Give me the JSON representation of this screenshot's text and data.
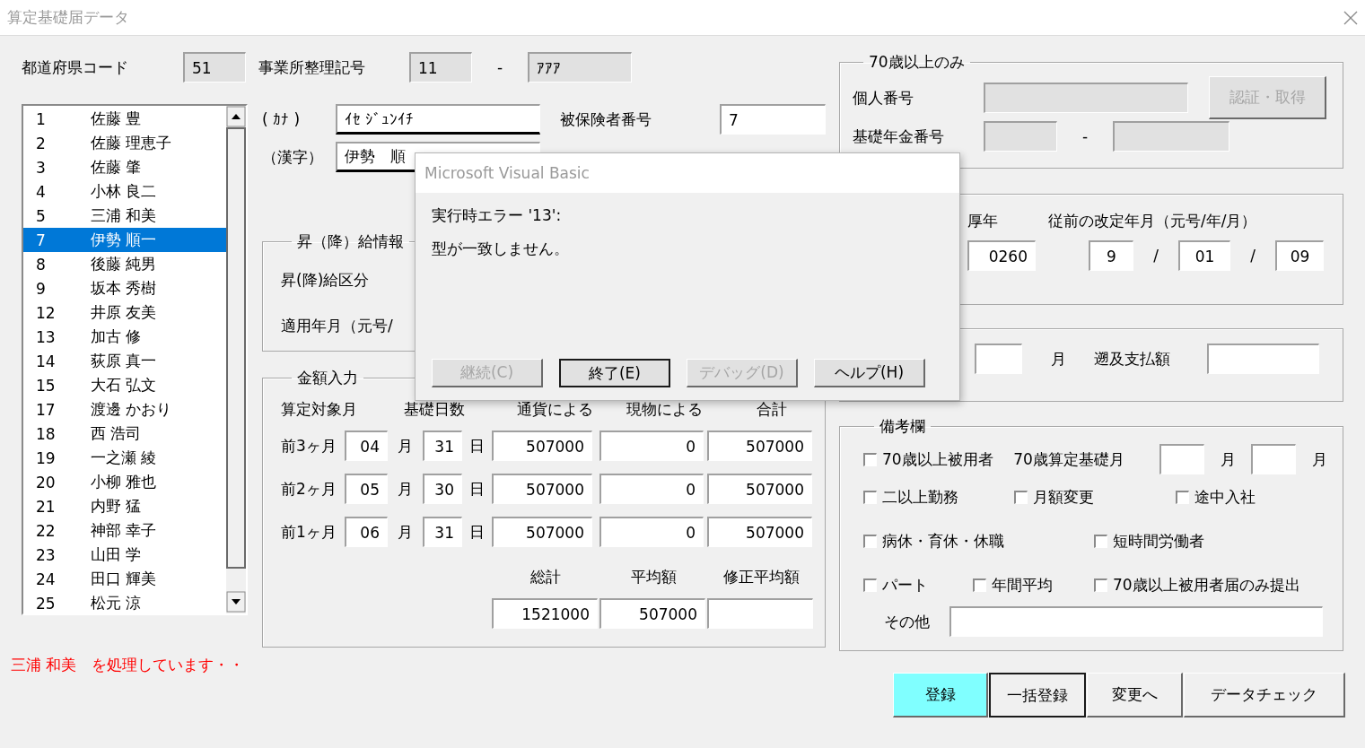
{
  "window": {
    "title": "算定基礎届データ"
  },
  "header": {
    "prefecture_label": "都道府県コード",
    "prefecture_code": "51",
    "office_label": "事業所整理記号",
    "office_code_1": "11",
    "office_separator": "-",
    "office_code_2": "ｱｱｱ"
  },
  "employee_list": [
    {
      "number": "1",
      "name": "佐藤 豊",
      "selected": false
    },
    {
      "number": "2",
      "name": "佐藤 理恵子",
      "selected": false
    },
    {
      "number": "3",
      "name": "佐藤 肇",
      "selected": false
    },
    {
      "number": "4",
      "name": "小林 良二",
      "selected": false
    },
    {
      "number": "5",
      "name": "三浦 和美",
      "selected": false
    },
    {
      "number": "7",
      "name": "伊勢 順一",
      "selected": true
    },
    {
      "number": "8",
      "name": "後藤 純男",
      "selected": false
    },
    {
      "number": "9",
      "name": "坂本 秀樹",
      "selected": false
    },
    {
      "number": "12",
      "name": "井原 友美",
      "selected": false
    },
    {
      "number": "13",
      "name": "加古 修",
      "selected": false
    },
    {
      "number": "14",
      "name": "荻原 真一",
      "selected": false
    },
    {
      "number": "15",
      "name": "大石 弘文",
      "selected": false
    },
    {
      "number": "17",
      "name": "渡邊 かおり",
      "selected": false
    },
    {
      "number": "18",
      "name": "西 浩司",
      "selected": false
    },
    {
      "number": "19",
      "name": "一之瀬 綾",
      "selected": false
    },
    {
      "number": "20",
      "name": "小柳 雅也",
      "selected": false
    },
    {
      "number": "21",
      "name": "内野 猛",
      "selected": false
    },
    {
      "number": "22",
      "name": "神部 幸子",
      "selected": false
    },
    {
      "number": "23",
      "name": "山田 学",
      "selected": false
    },
    {
      "number": "24",
      "name": "田口 輝美",
      "selected": false
    },
    {
      "number": "25",
      "name": "松元 涼",
      "selected": false
    }
  ],
  "status_message": "三浦 和美　を処理しています・・",
  "name_fields": {
    "kana_label": "( ｶﾅ )",
    "kana_value": "ｲｾ ｼﾞｭﾝｲﾁ",
    "insured_label": "被保険者番号",
    "insured_number": "7",
    "kanji_label": "（漢字）",
    "kanji_value": "伊勢　順"
  },
  "raise_info": {
    "title": "昇（降）給情報",
    "category_label": "昇(降)給区分",
    "applied_label": "適用年月（元号/"
  },
  "amounts": {
    "title": "金額入力",
    "headers": [
      "算定対象月",
      "基礎日数",
      "通貨による",
      "現物による",
      "合計"
    ],
    "rows": [
      {
        "label": "前3ヶ月",
        "month": "04",
        "month_unit": "月",
        "days": "31",
        "day_unit": "日",
        "cash": "507000",
        "in_kind": "0",
        "total": "507000"
      },
      {
        "label": "前2ヶ月",
        "month": "05",
        "month_unit": "月",
        "days": "30",
        "day_unit": "日",
        "cash": "507000",
        "in_kind": "0",
        "total": "507000"
      },
      {
        "label": "前1ヶ月",
        "month": "06",
        "month_unit": "月",
        "days": "31",
        "day_unit": "日",
        "cash": "507000",
        "in_kind": "0",
        "total": "507000"
      }
    ],
    "summary": [
      {
        "label": "総計",
        "value": "1521000"
      },
      {
        "label": "平均額",
        "value": "507000"
      },
      {
        "label": "修正平均額"
      }
    ]
  },
  "over70": {
    "title": "70歳以上のみ",
    "my_number_label": "個人番号",
    "auth_button": {
      "label": "認証・取得",
      "disabled": true
    },
    "pension_label": "基礎年金番号",
    "pension_separator": "-"
  },
  "previous_revision": {
    "pension_label": "厚年",
    "pension_value": "0260",
    "revision_label": "従前の改定年月（元号/年/月）",
    "era": "9",
    "year": "01",
    "month": "09",
    "separators": [
      "/",
      "/"
    ]
  },
  "retro": {
    "month_unit": "月",
    "payment_label": "遡及支払額"
  },
  "remarks": {
    "title": "備考欄",
    "base_month_label": "70歳算定基礎月",
    "month_units": [
      "月",
      "月"
    ],
    "other_label": "その他",
    "check_rows": [
      [
        {
          "label": "70歳以上被用者",
          "checked": false
        }
      ],
      [
        {
          "label": "二以上勤務",
          "checked": false
        },
        {
          "label": "月額変更",
          "checked": false
        },
        {
          "label": "途中入社",
          "checked": false
        }
      ],
      [
        {
          "label": "病休・育休・休職",
          "checked": false
        },
        {
          "label": "短時間労働者",
          "checked": false
        }
      ],
      [
        {
          "label": "パート",
          "checked": false
        },
        {
          "label": "年間平均",
          "checked": false
        },
        {
          "label": "70歳以上被用者届のみ提出",
          "checked": false
        }
      ]
    ]
  },
  "actions": [
    {
      "label": "登録",
      "color": "#80ffff",
      "default": false
    },
    {
      "label": "一括登録",
      "color": "#f0f0f0",
      "default": true
    },
    {
      "label": "変更へ",
      "color": "#f0f0f0",
      "default": false
    },
    {
      "label": "データチェック",
      "color": "#f0f0f0",
      "default": false
    }
  ],
  "dialog": {
    "title": "Microsoft Visual Basic",
    "lines": [
      "実行時エラー '13':",
      "型が一致しません。"
    ],
    "buttons": [
      {
        "label": "継続(C)",
        "disabled": true,
        "default": false
      },
      {
        "label": "終了(E)",
        "disabled": false,
        "default": true
      },
      {
        "label": "デバッグ(D)",
        "disabled": true,
        "default": false
      },
      {
        "label": "ヘルプ(H)",
        "disabled": false,
        "default": false
      }
    ]
  }
}
